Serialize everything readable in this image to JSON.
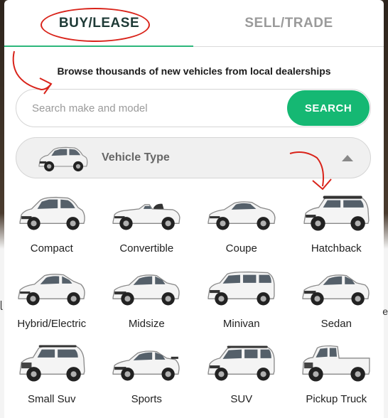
{
  "tabs": [
    {
      "label": "BUY/LEASE",
      "active": true
    },
    {
      "label": "SELL/TRADE",
      "active": false
    }
  ],
  "tagline": "Browse thousands of new vehicles from local dealerships",
  "search": {
    "placeholder": "Search make and model",
    "value": "",
    "button_label": "SEARCH"
  },
  "vehicle_type": {
    "label": "Vehicle Type",
    "expanded": true
  },
  "vehicle_types": [
    {
      "label": "Compact",
      "icon": "compact-car-icon"
    },
    {
      "label": "Convertible",
      "icon": "convertible-car-icon"
    },
    {
      "label": "Coupe",
      "icon": "coupe-car-icon"
    },
    {
      "label": "Hatchback",
      "icon": "hatchback-car-icon"
    },
    {
      "label": "Hybrid/Electric",
      "icon": "hybrid-electric-car-icon"
    },
    {
      "label": "Midsize",
      "icon": "midsize-car-icon"
    },
    {
      "label": "Minivan",
      "icon": "minivan-icon"
    },
    {
      "label": "Sedan",
      "icon": "sedan-car-icon"
    },
    {
      "label": "Small Suv",
      "icon": "small-suv-icon"
    },
    {
      "label": "Sports",
      "icon": "sports-car-icon"
    },
    {
      "label": "SUV",
      "icon": "suv-icon"
    },
    {
      "label": "Pickup Truck",
      "icon": "pickup-truck-icon"
    }
  ],
  "colors": {
    "accent_green": "#15b873",
    "annotation_red": "#d9231a",
    "active_tab_text": "#1e3a36",
    "inactive_tab_text": "#9a9a9a"
  }
}
